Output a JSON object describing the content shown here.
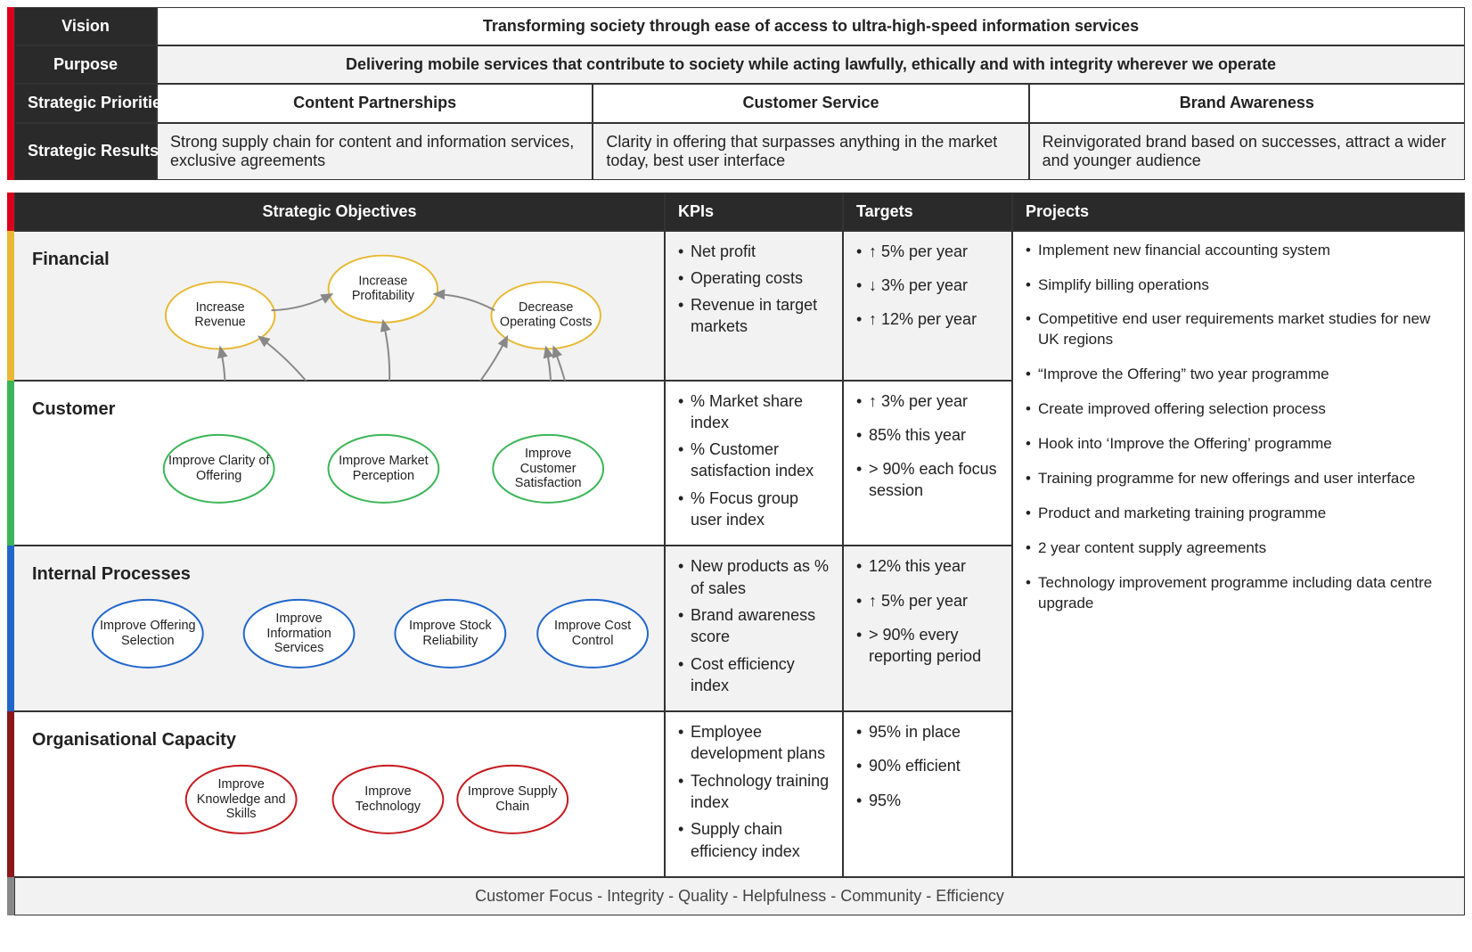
{
  "top": {
    "labels": {
      "vision": "Vision",
      "purpose": "Purpose",
      "priorities": "Strategic Priorities",
      "results": "Strategic Results"
    },
    "vision": "Transforming society through ease of access to ultra-high-speed information services",
    "purpose": "Delivering mobile services that contribute to society while acting lawfully, ethically and with integrity wherever we operate",
    "priorities": [
      "Content Partnerships",
      "Customer Service",
      "Brand Awareness"
    ],
    "results": [
      "Strong supply chain for content and information services, exclusive agreements",
      "Clarity in offering that surpasses anything in the market today, best user interface",
      "Reinvigorated brand based on successes, attract a wider and younger audience"
    ]
  },
  "headers": {
    "objectives": "Strategic Objectives",
    "kpis": "KPIs",
    "targets": "Targets",
    "projects": "Projects"
  },
  "perspectives": [
    {
      "key": "financial",
      "label": "Financial",
      "color": "#e8b933",
      "objectives": [
        {
          "id": "fin1",
          "text": "Increase Revenue"
        },
        {
          "id": "fin2",
          "text": "Increase Profitability"
        },
        {
          "id": "fin3",
          "text": "Decrease Operating Costs"
        }
      ],
      "kpis": [
        "Net profit",
        "Operating costs",
        "Revenue in target markets"
      ],
      "targets": [
        "↑ 5% per year",
        "↓ 3% per year",
        "↑ 12% per year"
      ]
    },
    {
      "key": "customer",
      "label": "Customer",
      "color": "#3cb557",
      "objectives": [
        {
          "id": "cus1",
          "text": "Improve Clarity of Offering"
        },
        {
          "id": "cus2",
          "text": "Improve Market Perception"
        },
        {
          "id": "cus3",
          "text": "Improve Customer Satisfaction"
        }
      ],
      "kpis": [
        "% Market share index",
        "% Customer satisfaction index",
        "% Focus group user index"
      ],
      "targets": [
        "↑ 3% per year",
        "85% this year",
        "> 90% each focus session"
      ]
    },
    {
      "key": "internal",
      "label": "Internal Processes",
      "color": "#2266cc",
      "objectives": [
        {
          "id": "int1",
          "text": "Improve Offering Selection"
        },
        {
          "id": "int2",
          "text": "Improve Information Services"
        },
        {
          "id": "int3",
          "text": "Improve Stock Reliability"
        },
        {
          "id": "int4",
          "text": "Improve Cost Control"
        }
      ],
      "kpis": [
        "New products as % of sales",
        "Brand awareness score",
        "Cost efficiency index"
      ],
      "targets": [
        "12% this year",
        "↑ 5% per year",
        "> 90% every reporting period"
      ]
    },
    {
      "key": "org",
      "label": "Organisational Capacity",
      "color": "#8a171a",
      "objectives": [
        {
          "id": "org1",
          "text": "Improve Knowledge and Skills"
        },
        {
          "id": "org2",
          "text": "Improve Technology"
        },
        {
          "id": "org3",
          "text": "Improve Supply Chain"
        }
      ],
      "kpis": [
        "Employee development plans",
        "Technology training index",
        "Supply chain efficiency index"
      ],
      "targets": [
        "95% in place",
        "90% efficient",
        "95%"
      ]
    }
  ],
  "projects": [
    "Implement new financial accounting system",
    "Simplify billing operations",
    "Competitive end user requirements market studies for new UK regions",
    "“Improve the Offering” two year programme",
    "Create improved offering selection process",
    "Hook into ‘Improve the Offering’ programme",
    "Training programme for new offerings and user interface",
    "Product and marketing training programme",
    "2 year content supply agreements",
    "Technology improvement programme including data centre upgrade"
  ],
  "values": [
    "Customer Focus",
    "Integrity",
    "Quality",
    "Helpfulness",
    "Community",
    "Efficiency"
  ],
  "chart_data": {
    "type": "strategy-map",
    "perspectives": [
      "Financial",
      "Customer",
      "Internal Processes",
      "Organisational Capacity"
    ],
    "nodes": [
      {
        "id": "fin1",
        "label": "Increase Revenue",
        "perspective": "Financial"
      },
      {
        "id": "fin2",
        "label": "Increase Profitability",
        "perspective": "Financial"
      },
      {
        "id": "fin3",
        "label": "Decrease Operating Costs",
        "perspective": "Financial"
      },
      {
        "id": "cus1",
        "label": "Improve Clarity of Offering",
        "perspective": "Customer"
      },
      {
        "id": "cus2",
        "label": "Improve Market Perception",
        "perspective": "Customer"
      },
      {
        "id": "cus3",
        "label": "Improve Customer Satisfaction",
        "perspective": "Customer"
      },
      {
        "id": "int1",
        "label": "Improve Offering Selection",
        "perspective": "Internal Processes"
      },
      {
        "id": "int2",
        "label": "Improve Information Services",
        "perspective": "Internal Processes"
      },
      {
        "id": "int3",
        "label": "Improve Stock Reliability",
        "perspective": "Internal Processes"
      },
      {
        "id": "int4",
        "label": "Improve Cost Control",
        "perspective": "Internal Processes"
      },
      {
        "id": "org1",
        "label": "Improve Knowledge and Skills",
        "perspective": "Organisational Capacity"
      },
      {
        "id": "org2",
        "label": "Improve Technology",
        "perspective": "Organisational Capacity"
      },
      {
        "id": "org3",
        "label": "Improve Supply Chain",
        "perspective": "Organisational Capacity"
      }
    ],
    "links": [
      {
        "from": "fin1",
        "to": "fin2"
      },
      {
        "from": "fin3",
        "to": "fin2"
      },
      {
        "from": "cus1",
        "to": "fin1"
      },
      {
        "from": "cus2",
        "to": "fin1"
      },
      {
        "from": "cus2",
        "to": "fin2"
      },
      {
        "from": "cus3",
        "to": "fin3"
      },
      {
        "from": "cus2",
        "to": "fin3"
      },
      {
        "from": "int1",
        "to": "cus1"
      },
      {
        "from": "int2",
        "to": "cus1"
      },
      {
        "from": "int2",
        "to": "cus2"
      },
      {
        "from": "int3",
        "to": "cus2"
      },
      {
        "from": "int3",
        "to": "cus3"
      },
      {
        "from": "int4",
        "to": "cus3"
      },
      {
        "from": "int4",
        "to": "fin3"
      },
      {
        "from": "org1",
        "to": "int1"
      },
      {
        "from": "org1",
        "to": "int2"
      },
      {
        "from": "org2",
        "to": "int2"
      },
      {
        "from": "org2",
        "to": "int3"
      },
      {
        "from": "org3",
        "to": "int3"
      },
      {
        "from": "org3",
        "to": "int4"
      }
    ]
  }
}
